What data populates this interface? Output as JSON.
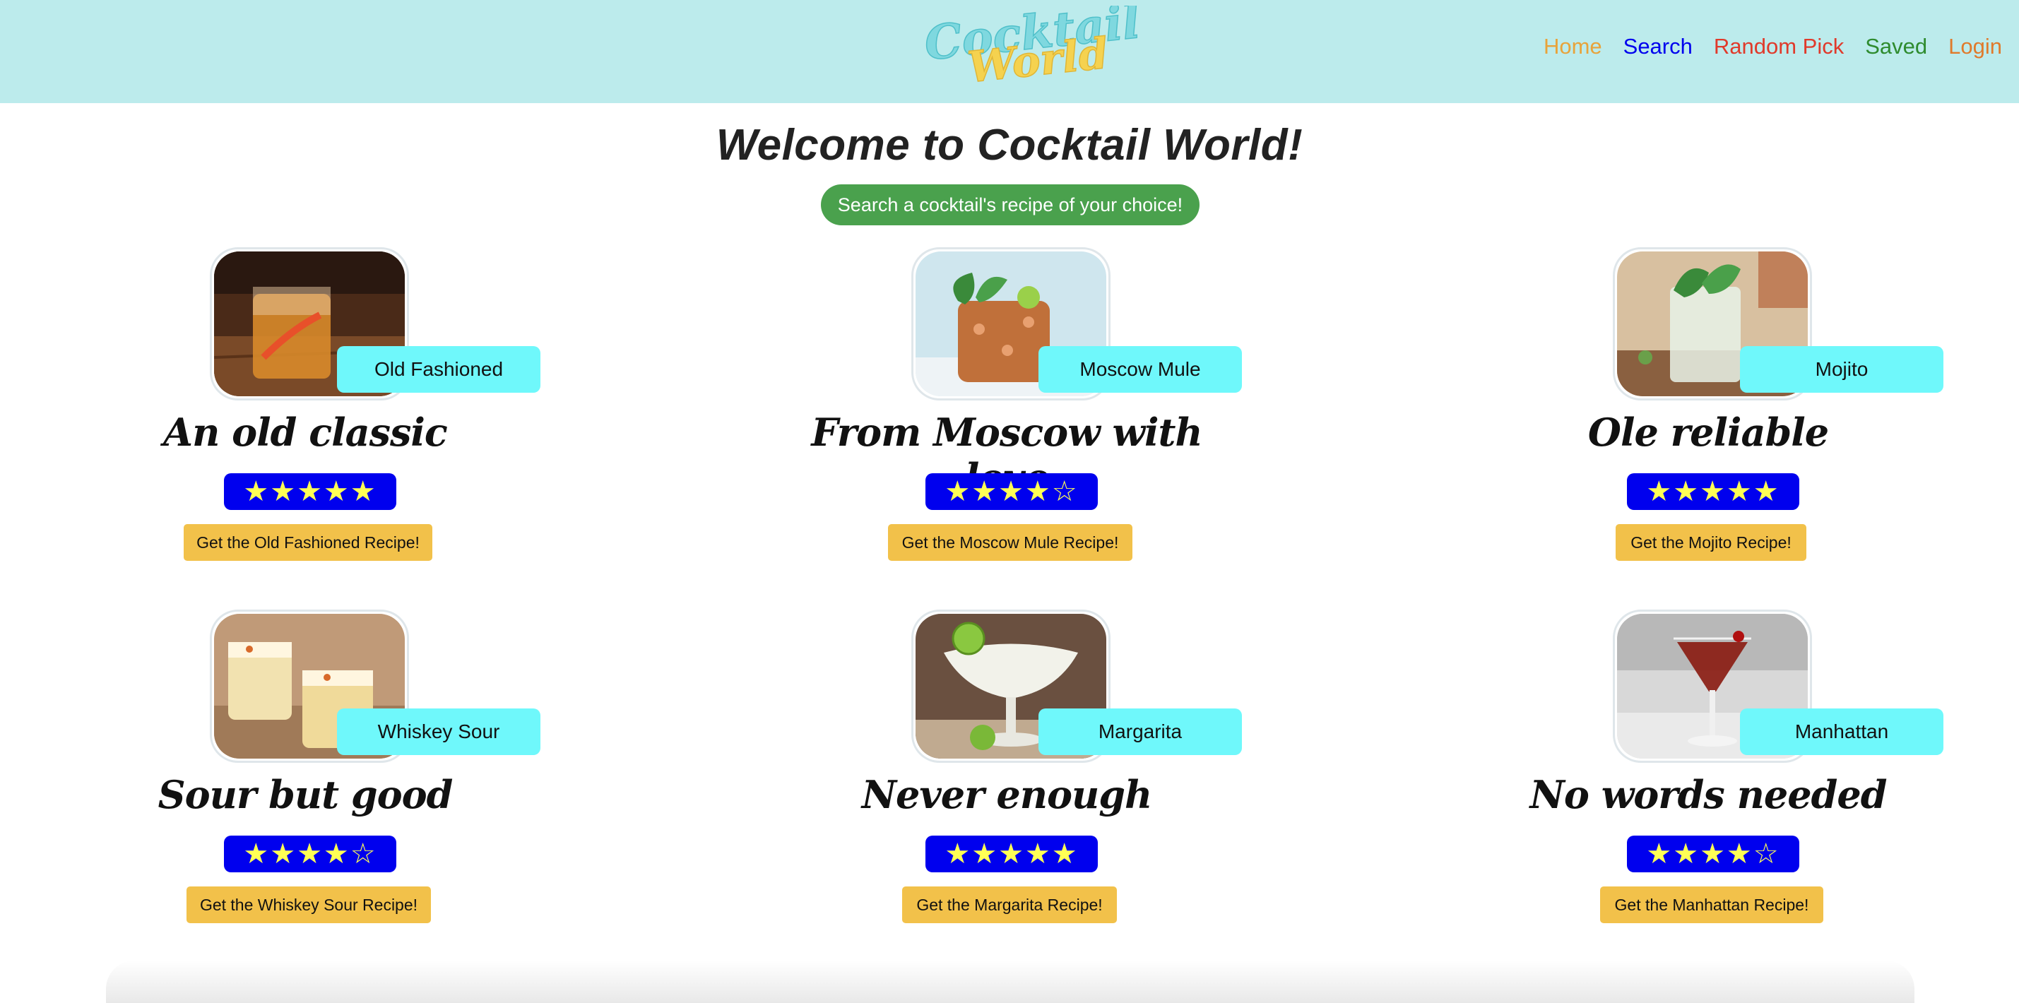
{
  "nav": {
    "logo_text_1": "Cocktail",
    "logo_text_2": "World",
    "links": [
      {
        "label": "Home",
        "color": "#e8a33a"
      },
      {
        "label": "Search",
        "color": "#0000ee"
      },
      {
        "label": "Random Pick",
        "color": "#e03a2b"
      },
      {
        "label": "Saved",
        "color": "#2e8b2e"
      },
      {
        "label": "Login",
        "color": "#e07a2b"
      }
    ]
  },
  "main": {
    "title": "Welcome to Cocktail World!",
    "search_pill": "Search a cocktail's recipe of your choice!"
  },
  "cards": [
    {
      "name": "Old Fashioned",
      "tagline": "An old classic",
      "stars": "★★★★★",
      "rating": 5,
      "button": "Get the Old Fashioned Recipe!",
      "icon": "whiskey-glass-icon"
    },
    {
      "name": "Moscow Mule",
      "tagline": "From Moscow with love",
      "stars": "★★★★☆",
      "rating": 4,
      "button": "Get the Moscow Mule Recipe!",
      "icon": "copper-mug-icon"
    },
    {
      "name": "Mojito",
      "tagline": "Ole reliable",
      "stars": "★★★★★",
      "rating": 5,
      "button": "Get the Mojito Recipe!",
      "icon": "mojito-glass-icon"
    },
    {
      "name": "Whiskey Sour",
      "tagline": "Sour but good",
      "stars": "★★★★☆",
      "rating": 4,
      "button": "Get the Whiskey Sour Recipe!",
      "icon": "sour-glass-icon"
    },
    {
      "name": "Margarita",
      "tagline": "Never enough",
      "stars": "★★★★★",
      "rating": 5,
      "button": "Get the Margarita Recipe!",
      "icon": "margarita-glass-icon"
    },
    {
      "name": "Manhattan",
      "tagline": "No words needed",
      "stars": "★★★★☆",
      "rating": 4,
      "button": "Get the Manhattan Recipe!",
      "icon": "martini-glass-icon"
    }
  ],
  "colors": {
    "navbar_bg": "#bcebec",
    "name_tag_bg": "#6ff8fb",
    "stars_bg": "#0000ee",
    "star_color": "#ffff55",
    "button_bg": "#f2c14a",
    "pill_bg": "#4aa14d"
  }
}
